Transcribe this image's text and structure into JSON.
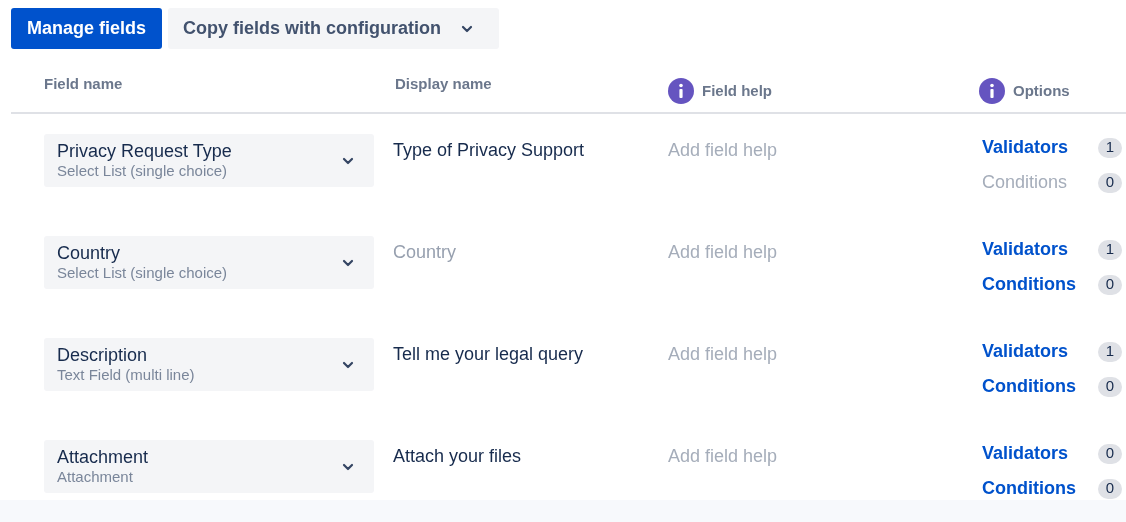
{
  "toolbar": {
    "primary_button": "Manage fields",
    "dropdown_button": "Copy fields with configuration"
  },
  "table": {
    "columns": [
      {
        "label": "Field name",
        "kind": "plain"
      },
      {
        "label": "Display name",
        "kind": "plain"
      },
      {
        "label": "Field help",
        "kind": "info"
      },
      {
        "label": "Options",
        "kind": "info"
      }
    ],
    "rows": [
      {
        "field": "Privacy Request Type",
        "type": "Select List (single choice)",
        "display_name": {
          "value": "Type of Privacy Support"
        },
        "field_help": {
          "placeholder": "Add field help"
        },
        "options": [
          {
            "label": "Validators",
            "count": "1",
            "disabled": false
          },
          {
            "label": "Conditions",
            "count": "0",
            "disabled": true
          }
        ]
      },
      {
        "field": "Country",
        "type": "Select List (single choice)",
        "display_name": {
          "placeholder": "Country"
        },
        "field_help": {
          "placeholder": "Add field help"
        },
        "options": [
          {
            "label": "Validators",
            "count": "1",
            "disabled": false
          },
          {
            "label": "Conditions",
            "count": "0",
            "disabled": false
          }
        ]
      },
      {
        "field": "Description",
        "type": "Text Field (multi line)",
        "display_name": {
          "value": "Tell me your legal query"
        },
        "field_help": {
          "placeholder": "Add field help"
        },
        "options": [
          {
            "label": "Validators",
            "count": "1",
            "disabled": false
          },
          {
            "label": "Conditions",
            "count": "0",
            "disabled": false
          }
        ]
      },
      {
        "field": "Attachment",
        "type": "Attachment",
        "display_name": {
          "value": "Attach your files"
        },
        "field_help": {
          "placeholder": "Add field help"
        },
        "options": [
          {
            "label": "Validators",
            "count": "0",
            "disabled": false
          },
          {
            "label": "Conditions",
            "count": "0",
            "disabled": false
          }
        ]
      }
    ]
  }
}
